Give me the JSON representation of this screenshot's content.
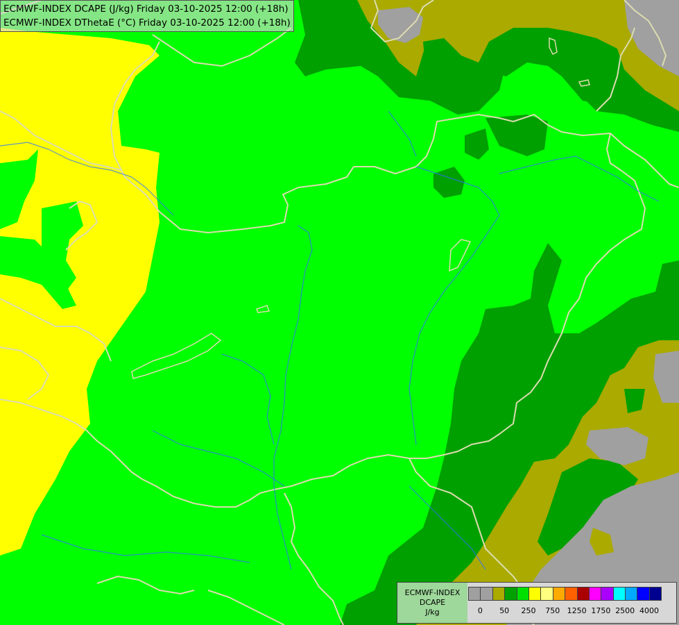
{
  "map": {
    "title_lines": [
      "ECMWF-INDEX DCAPE (J/kg) Friday 03-10-2025 12:00 (+18h)",
      "ECMWF-INDEX DThetaE (°C) Friday 03-10-2025 12:00 (+18h)"
    ],
    "colors": {
      "grey": "#a0a0a0",
      "olive": "#aaaa00",
      "dark_green": "#00a000",
      "bright_green": "#00ff00",
      "yellow": "#ffff00",
      "border": "#dcdcb0",
      "river": "#3070ff"
    }
  },
  "legend": {
    "title_lines": [
      "ECMWF-INDEX",
      "DCAPE",
      "J/kg"
    ],
    "swatch_colors": [
      "#a0a0a0",
      "#a0a0a0",
      "#aaaa00",
      "#00a000",
      "#00e000",
      "#ffff00",
      "#ffff80",
      "#ffaa00",
      "#ff6000",
      "#aa0000",
      "#ff00ff",
      "#aa00ff",
      "#00ffff",
      "#00aaff",
      "#0000ff",
      "#000090"
    ],
    "tick_labels": [
      "0",
      "50",
      "250",
      "750",
      "1250",
      "1750",
      "2500",
      "4000"
    ]
  }
}
